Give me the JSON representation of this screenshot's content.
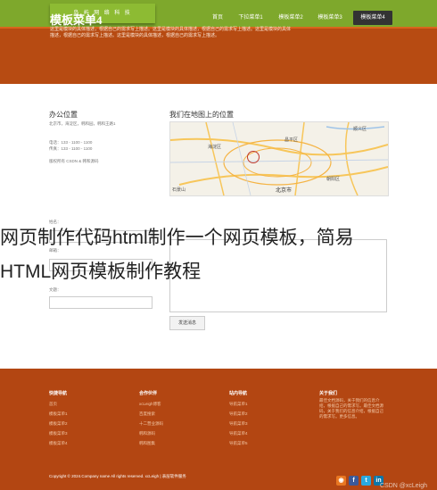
{
  "header": {
    "logo_text": "岛 屿 网 络 科 技",
    "nav": [
      {
        "label": "首页"
      },
      {
        "label": "下拉菜单1"
      },
      {
        "label": "模板菜单2"
      },
      {
        "label": "模板菜单3"
      },
      {
        "label": "模板菜单4",
        "active": true
      }
    ]
  },
  "hero": {
    "title": "模板菜单4",
    "desc": "这里是模块的具体描述，根据自己的需求写上描述。这里是模块的具体描述，根据自己的需求写上描述。这里是模块的具体描述，根据自己的需求写上描述。这里是模块的具体描述，根据自己的需求写上描述。"
  },
  "contact": {
    "title": "办公位置",
    "address": "北京市，海淀区，韩和园，韩和王路1",
    "phone": "电话：133 - 1100 - 1100",
    "fax": "传真：133 - 1100 - 1100",
    "support": "版权所有 CSDN & 韩和源码"
  },
  "map": {
    "title": "我们在地图上的位置",
    "labels": [
      "海淀区",
      "昌平区",
      "北京市",
      "朝阳区",
      "石景山",
      "顺义区"
    ]
  },
  "form": {
    "name_label": "姓名：",
    "email_label": "邮箱：",
    "message_label": "文题：",
    "submit_label": "发送消息"
  },
  "overlay": {
    "line1": "网页制作代码html制作一个网页模板，简易",
    "line2": "HTML网页模板制作教程"
  },
  "footer": {
    "columns": [
      {
        "title": "快捷导航",
        "items": [
          "首页",
          "模板菜单1",
          "模板菜单2",
          "模板菜单3",
          "模板菜单4"
        ]
      },
      {
        "title": "合作伙伴",
        "items": [
          "xcLeigh博客",
          "百度搜索",
          "十二营业源码",
          "韩和源码",
          "韩和图集"
        ]
      },
      {
        "title": "站内导航",
        "items": [
          "导航菜单1",
          "导航菜单2",
          "导航菜单3",
          "导航菜单4",
          "导航菜单5"
        ]
      },
      {
        "title": "关于我们",
        "items": []
      }
    ],
    "about_text": "最佳文档源码，关于我们的信息介绍，根据自己的需求写。最佳文档源码，关于我们的信息介绍，根据自己的需求写。更多信息。",
    "copyright": "Copyright © 2024.Company name All rights reserved. xcLeigh | 表层软件服务",
    "social": [
      {
        "icon": "rss-icon",
        "glyph": "◉",
        "color": "#e87722"
      },
      {
        "icon": "facebook-icon",
        "glyph": "f",
        "color": "#3b5998"
      },
      {
        "icon": "twitter-icon",
        "glyph": "t",
        "color": "#2aa9e0"
      },
      {
        "icon": "linkedin-icon",
        "glyph": "in",
        "color": "#0e76a8"
      }
    ],
    "watermark": "CSDN @xcLeigh"
  }
}
